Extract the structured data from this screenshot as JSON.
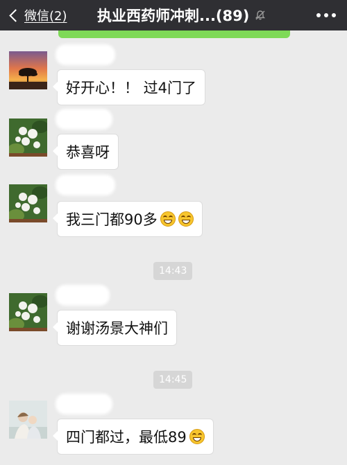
{
  "navbar": {
    "back_label": "微信(2)",
    "title": "执业西药师冲刺...(89)"
  },
  "messages": [
    {
      "text": "好开心！！ 过4门了",
      "emoji_count": 0,
      "avatar": "sunset-tree-avatar"
    },
    {
      "text": "恭喜呀",
      "emoji_count": 0,
      "avatar": "white-flower-avatar"
    },
    {
      "text": "我三门都90多",
      "emoji_count": 2,
      "avatar": "white-flower-avatar"
    },
    {
      "text": "谢谢汤景大神们",
      "emoji_count": 0,
      "avatar": "white-flower-avatar"
    },
    {
      "text": "四门都过，最低89",
      "emoji_count": 1,
      "avatar": "family-photo-avatar"
    }
  ],
  "timestamps": [
    "14:43",
    "14:45"
  ],
  "colors": {
    "navbar": "#2f2f33",
    "background": "#ebebeb",
    "bubble": "#ffffff",
    "accent_green": "#7ed957"
  }
}
